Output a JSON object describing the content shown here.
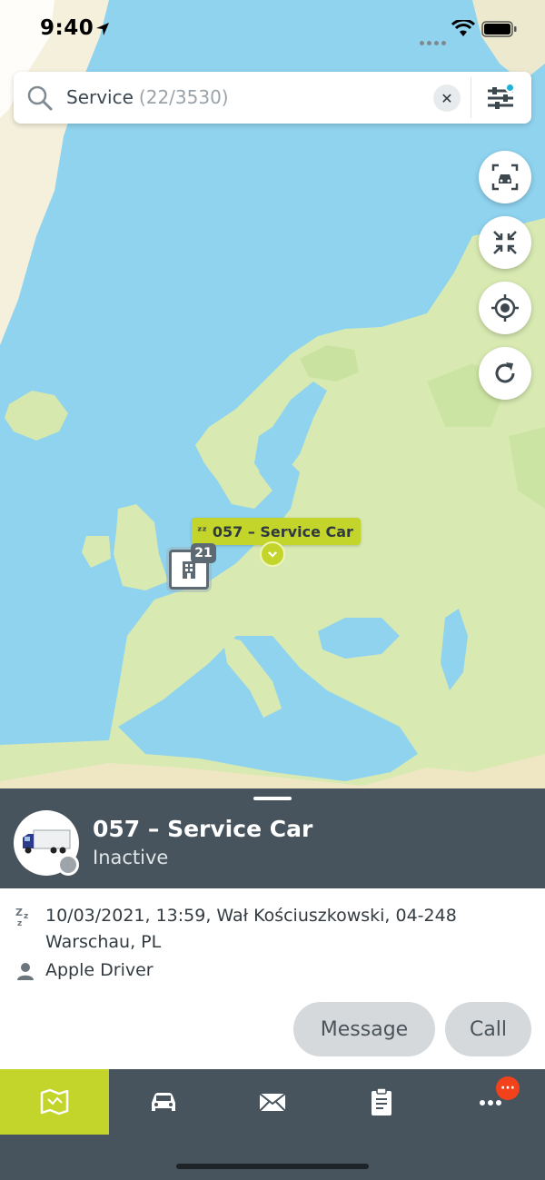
{
  "status_bar": {
    "time": "9:40"
  },
  "search": {
    "query": "Service",
    "count": "(22/3530)",
    "clear_symbol": "✕"
  },
  "map": {
    "vehicle_label": "057 – Service Car",
    "sleep_symbol": "ᶻᶻ",
    "cluster_count": "21"
  },
  "vehicle": {
    "title": "057 – Service Car",
    "status": "Inactive",
    "details": [
      {
        "icon": "sleep-icon",
        "text": "10/03/2021, 13:59, Wał Kościuszkowski, 04-248 Warschau, PL"
      },
      {
        "icon": "driver-icon",
        "text": "Apple Driver"
      }
    ]
  },
  "actions": {
    "message": "Message",
    "call": "Call"
  },
  "tabs": [
    {
      "icon": "map-icon",
      "active": true
    },
    {
      "icon": "car-icon"
    },
    {
      "icon": "mail-icon"
    },
    {
      "icon": "clipboard-icon"
    },
    {
      "icon": "more-icon",
      "badge": "···"
    }
  ],
  "colors": {
    "accent": "#c3d52b",
    "sheet": "#47545d",
    "water": "#8fd3ef",
    "land": "#d8eab2",
    "badge": "#f2421b",
    "filter_dot": "#1fb1d6"
  }
}
